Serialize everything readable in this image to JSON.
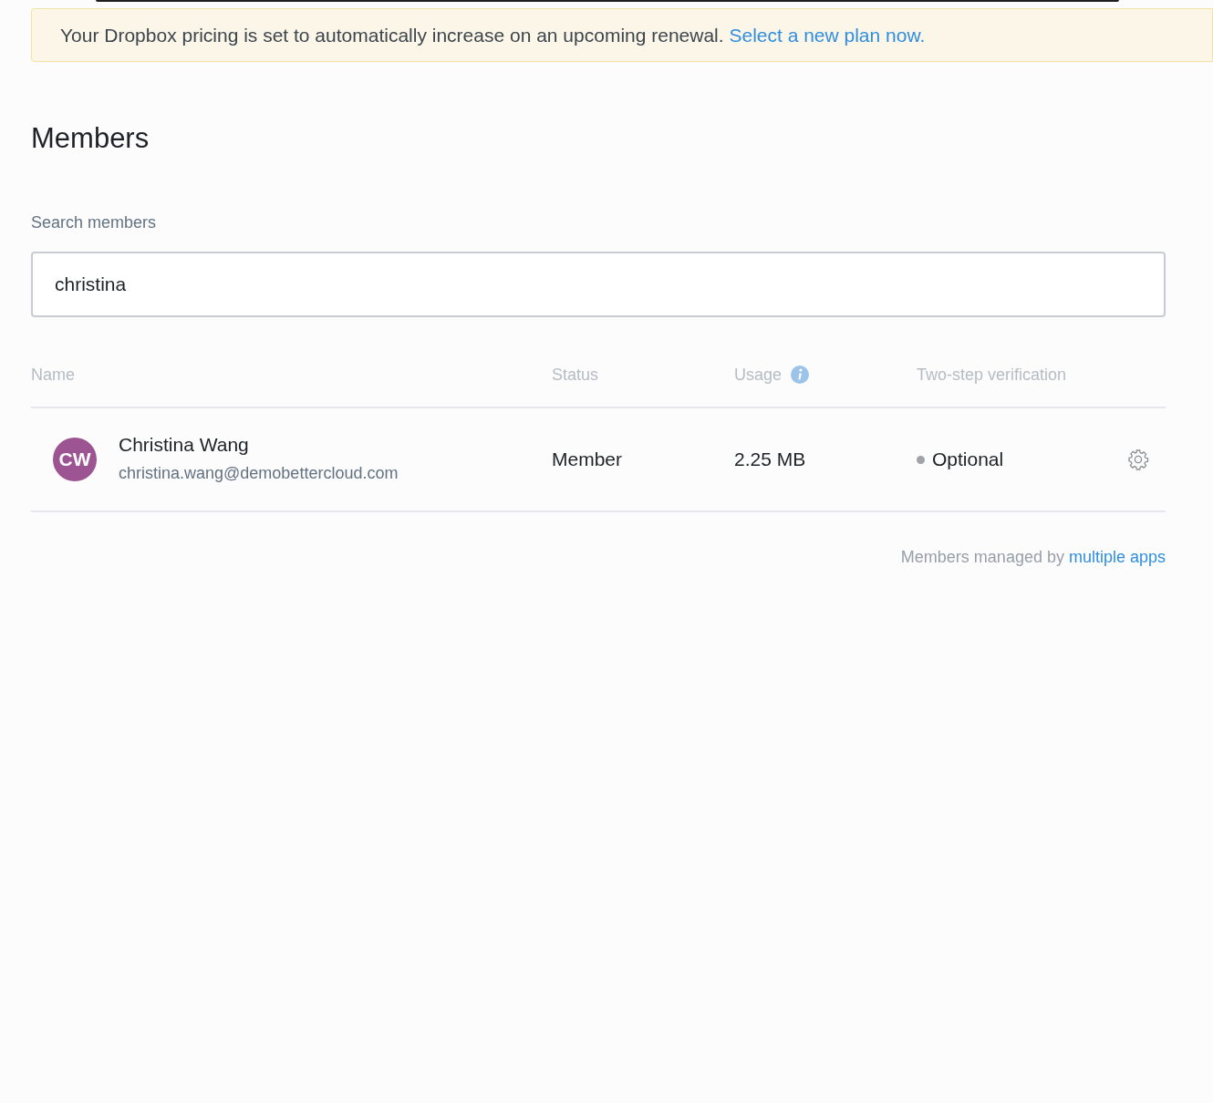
{
  "banner": {
    "text": "Your Dropbox pricing is set to automatically increase on an upcoming renewal.",
    "link": "Select a new plan now."
  },
  "heading": "Members",
  "search": {
    "label": "Search members",
    "value": "christina"
  },
  "table": {
    "columns": [
      "Name",
      "Status",
      "Usage",
      "Two-step verification"
    ],
    "rows": [
      {
        "initials": "CW",
        "name": "Christina Wang",
        "email": "christina.wang@demobettercloud.com",
        "status": "Member",
        "usage": "2.25 MB",
        "two_step": "Optional"
      }
    ]
  },
  "footer": {
    "text": "Members managed by",
    "link": "multiple apps"
  }
}
